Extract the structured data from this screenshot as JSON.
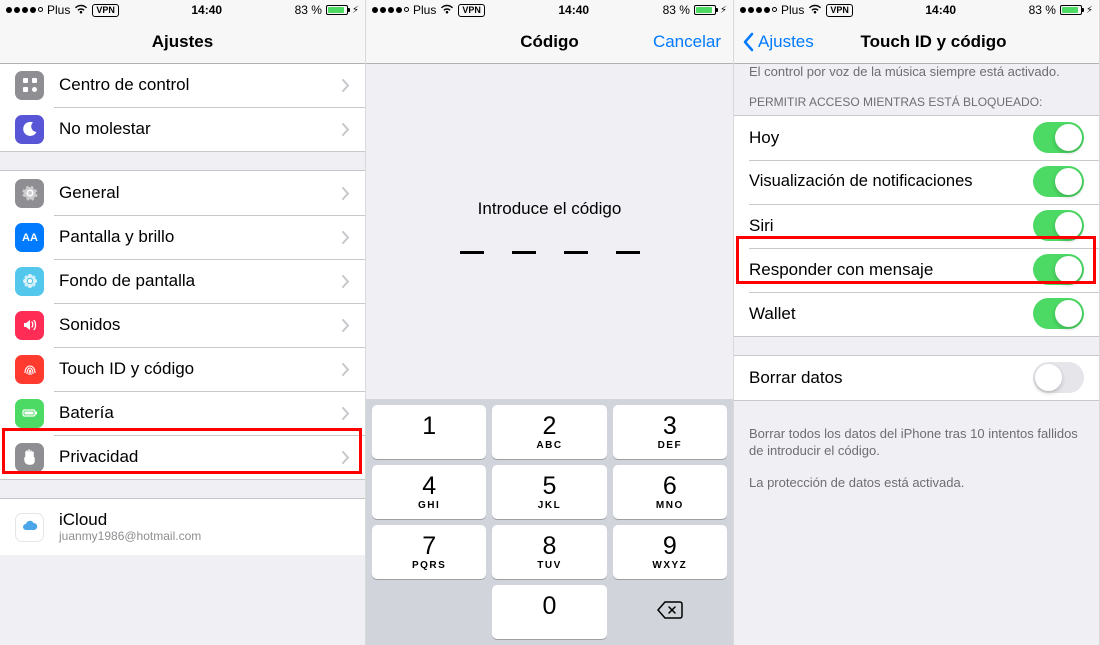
{
  "status": {
    "carrier": "Plus",
    "vpn": "VPN",
    "time": "14:40",
    "battery_pct": "83 %"
  },
  "screen1": {
    "title": "Ajustes",
    "items_g1": [
      {
        "label": "Centro de control",
        "icon": "control-center",
        "bg": "#8e8e93"
      },
      {
        "label": "No molestar",
        "icon": "moon",
        "bg": "#5856d6"
      }
    ],
    "items_g2": [
      {
        "label": "General",
        "icon": "gear",
        "bg": "#8e8e93"
      },
      {
        "label": "Pantalla y brillo",
        "icon": "aa",
        "bg": "#007aff"
      },
      {
        "label": "Fondo de pantalla",
        "icon": "flower",
        "bg": "#54c7ec"
      },
      {
        "label": "Sonidos",
        "icon": "speaker",
        "bg": "#ff2d55"
      },
      {
        "label": "Touch ID y código",
        "icon": "fingerprint",
        "bg": "#ff3b30"
      },
      {
        "label": "Batería",
        "icon": "battery",
        "bg": "#4cd964"
      },
      {
        "label": "Privacidad",
        "icon": "hand",
        "bg": "#8e8e93"
      }
    ],
    "items_g3": [
      {
        "label": "iCloud",
        "sub": "juanmy1986@hotmail.com",
        "icon": "cloud",
        "bg": "#ffffff"
      }
    ]
  },
  "screen2": {
    "title": "Código",
    "cancel": "Cancelar",
    "prompt": "Introduce el código",
    "keys": [
      {
        "n": "1",
        "l": ""
      },
      {
        "n": "2",
        "l": "ABC"
      },
      {
        "n": "3",
        "l": "DEF"
      },
      {
        "n": "4",
        "l": "GHI"
      },
      {
        "n": "5",
        "l": "JKL"
      },
      {
        "n": "6",
        "l": "MNO"
      },
      {
        "n": "7",
        "l": "PQRS"
      },
      {
        "n": "8",
        "l": "TUV"
      },
      {
        "n": "9",
        "l": "WXYZ"
      }
    ],
    "zero": "0"
  },
  "screen3": {
    "back": "Ajustes",
    "title": "Touch ID y código",
    "top_note": "El control por voz de la música siempre está activado.",
    "section_header": "PERMITIR ACCESO MIENTRAS ESTÁ BLOQUEADO:",
    "toggles": [
      {
        "label": "Hoy",
        "on": true
      },
      {
        "label": "Visualización de notificaciones",
        "on": true
      },
      {
        "label": "Siri",
        "on": true
      },
      {
        "label": "Responder con mensaje",
        "on": true
      },
      {
        "label": "Wallet",
        "on": true
      }
    ],
    "erase": {
      "label": "Borrar datos",
      "on": false
    },
    "footer1": "Borrar todos los datos del iPhone tras 10 intentos fallidos de introducir el código.",
    "footer2": "La protección de datos está activada."
  }
}
